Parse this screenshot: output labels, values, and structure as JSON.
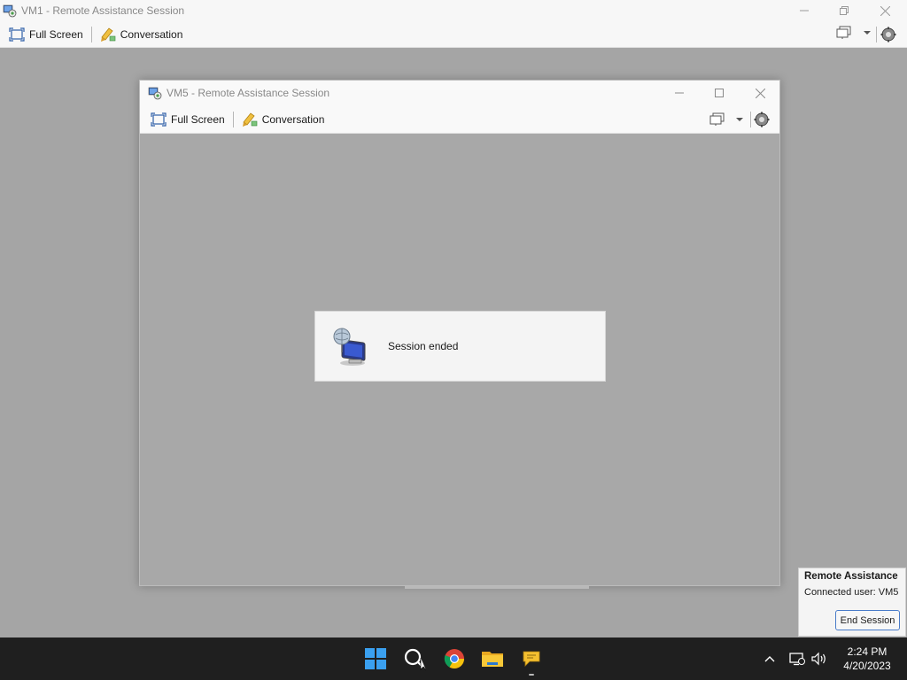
{
  "outer_window": {
    "title": "VM1 - Remote Assistance Session",
    "toolbar": {
      "full_screen_label": "Full Screen",
      "conversation_label": "Conversation"
    }
  },
  "inner_window": {
    "title": "VM5 - Remote Assistance Session",
    "toolbar": {
      "full_screen_label": "Full Screen",
      "conversation_label": "Conversation"
    }
  },
  "session_dialog": {
    "message": "Session ended"
  },
  "remote_assistance_popup": {
    "title": "Remote Assistance",
    "connected_user": "Connected user:  VM5",
    "end_session_label": "End Session"
  },
  "taskbar": {
    "icons": [
      "windows-start-icon",
      "search-icon",
      "chrome-icon",
      "file-explorer-icon",
      "remote-assistance-icon"
    ],
    "clock": {
      "time": "2:24 PM",
      "date": "4/20/2023"
    }
  },
  "colors": {
    "desktop": "#a5a5a5",
    "titlebar": "#f7f7f7",
    "taskbar": "#1f1f1f",
    "accent": "#4a7cc9"
  }
}
